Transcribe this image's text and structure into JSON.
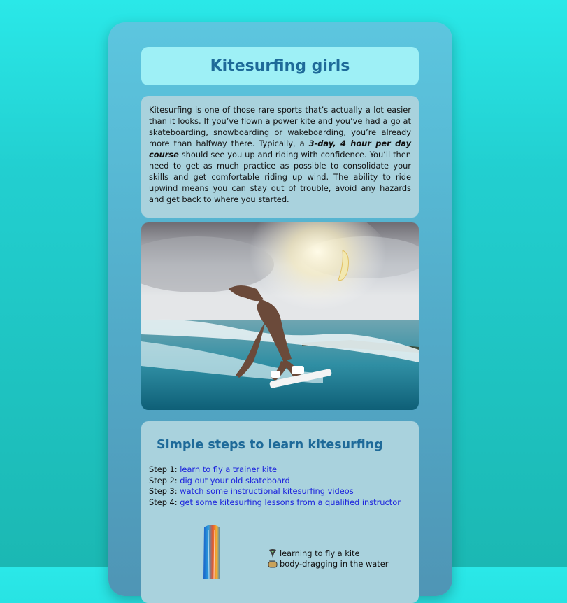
{
  "page": {
    "title": "Kitesurfing girls"
  },
  "intro": {
    "before": "Kitesurfing is one of those rare sports that’s actually a lot easier than it looks. If you’ve flown a power kite and you’ve had a go at skateboarding, snowboarding or wakeboarding, you’re already more than halfway there. Typically, a ",
    "emphasis": "3-day, 4 hour per day course",
    "after": " should see you up and riding with confidence. You’ll then need to get as much practice as possible to consolidate your skills and get comfortable riding up wind. The ability to ride upwind means you can stay out of trouble, avoid any hazards and get back to where you started."
  },
  "steps": {
    "title": "Simple steps to learn kitesurfing",
    "items": [
      {
        "prefix": "Step 1: ",
        "link": "learn to fly a trainer kite"
      },
      {
        "prefix": "Step 2: ",
        "link": "dig out your old skateboard"
      },
      {
        "prefix": "Step 3: ",
        "link": "watch some instructional kitesurfing videos"
      },
      {
        "prefix": "Step 4: ",
        "link": "get some kitesurfing lessons from a qualified instructor"
      }
    ]
  },
  "features": [
    {
      "icon": "kite-icon",
      "label": "learning to fly a kite"
    },
    {
      "icon": "hand-icon",
      "label": "body-dragging in the water"
    }
  ],
  "colors": {
    "title": "#1e6a99",
    "link": "#1b22dd",
    "background": "#2ae8e8"
  }
}
